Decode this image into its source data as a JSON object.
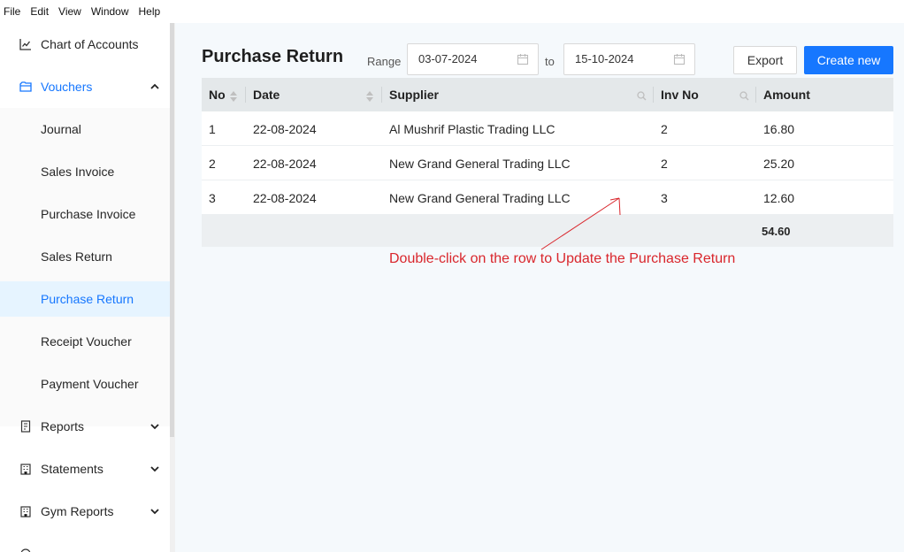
{
  "menubar": [
    "File",
    "Edit",
    "View",
    "Window",
    "Help"
  ],
  "sidebar": {
    "chart_of_accounts": "Chart of Accounts",
    "vouchers": "Vouchers",
    "journal": "Journal",
    "sales_invoice": "Sales Invoice",
    "purchase_invoice": "Purchase Invoice",
    "sales_return": "Sales Return",
    "purchase_return": "Purchase Return",
    "receipt_voucher": "Receipt Voucher",
    "payment_voucher": "Payment Voucher",
    "reports": "Reports",
    "statements": "Statements",
    "gym_reports": "Gym Reports",
    "active_color": "#1677ff"
  },
  "page": {
    "title": "Purchase Return",
    "range_label": "Range",
    "to_label": "to",
    "range_start": "03-07-2024",
    "range_end": "15-10-2024",
    "export_label": "Export",
    "create_label": "Create new",
    "primary_color": "#1677ff"
  },
  "table": {
    "columns": [
      "No",
      "Date",
      "Supplier",
      "Inv No",
      "Amount"
    ],
    "rows": [
      {
        "no": "1",
        "date": "22-08-2024",
        "supplier": "Al Mushrif Plastic Trading LLC",
        "inv": "2",
        "amount": "16.80"
      },
      {
        "no": "2",
        "date": "22-08-2024",
        "supplier": "New Grand General Trading LLC",
        "inv": "2",
        "amount": "25.20"
      },
      {
        "no": "3",
        "date": "22-08-2024",
        "supplier": "New Grand General Trading LLC",
        "inv": "3",
        "amount": "12.60"
      }
    ],
    "total": "54.60"
  },
  "annotation": {
    "text": "Double-click on the row to Update the Purchase Return",
    "color": "#d9262c"
  }
}
